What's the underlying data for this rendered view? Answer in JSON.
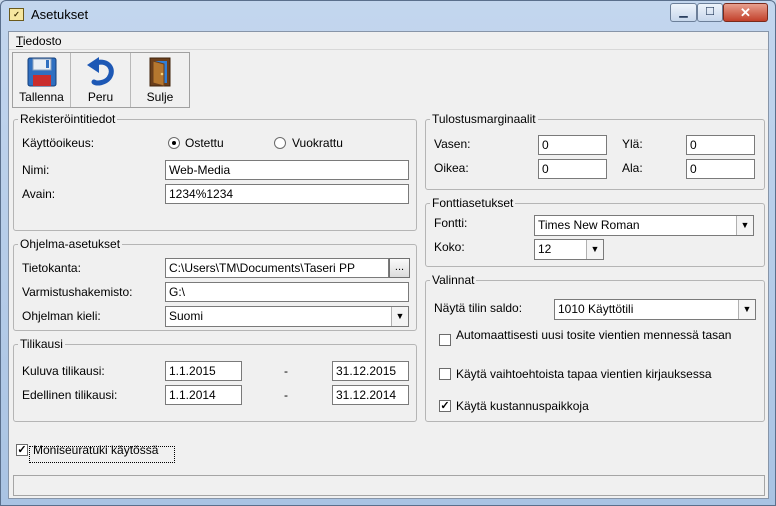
{
  "window": {
    "title": "Asetukset"
  },
  "menu": {
    "file_accel": "T",
    "file_rest": "iedosto"
  },
  "toolbar": {
    "save": "Tallenna",
    "undo": "Peru",
    "close": "Sulje"
  },
  "registration": {
    "legend": "Rekisteröintitiedot",
    "license_label": "Käyttöoikeus:",
    "license_options": [
      "Ostettu",
      "Vuokrattu"
    ],
    "license_selected": "Ostettu",
    "name_label": "Nimi:",
    "name_value": "Web-Media",
    "key_label": "Avain:",
    "key_value": "1234%1234"
  },
  "program": {
    "legend": "Ohjelma-asetukset",
    "database_label": "Tietokanta:",
    "database_value": "C:\\Users\\TM\\Documents\\Taseri PP",
    "browse_label": "...",
    "backup_label": "Varmistushakemisto:",
    "backup_value": "G:\\",
    "language_label": "Ohjelman kieli:",
    "language_value": "Suomi"
  },
  "fiscal": {
    "legend": "Tilikausi",
    "current_label": "Kuluva tilikausi:",
    "current_start": "1.1.2015",
    "current_end": "31.12.2015",
    "previous_label": "Edellinen tilikausi:",
    "previous_start": "1.1.2014",
    "previous_end": "31.12.2014",
    "dash": "-"
  },
  "multi_company": {
    "label": "Moniseuratuki käytössä",
    "checked": true
  },
  "margins": {
    "legend": "Tulostusmarginaalit",
    "left_label": "Vasen:",
    "left_value": "0",
    "top_label": "Ylä:",
    "top_value": "0",
    "right_label": "Oikea:",
    "right_value": "0",
    "bottom_label": "Ala:",
    "bottom_value": "0"
  },
  "fonts": {
    "legend": "Fonttiasetukset",
    "font_label": "Fontti:",
    "font_value": "Times New Roman",
    "size_label": "Koko:",
    "size_value": "12"
  },
  "options": {
    "legend": "Valinnat",
    "balance_label": "Näytä tilin saldo:",
    "balance_value": "1010 Käyttötili",
    "auto_voucher_label": "Automaattisesti uusi tosite vientien mennessä tasan",
    "auto_voucher_checked": false,
    "alt_entry_label": "Käytä vaihtoehtoista tapaa vientien kirjauksessa",
    "alt_entry_checked": false,
    "cost_centers_label": "Käytä kustannuspaikkoja",
    "cost_centers_checked": true
  },
  "colors": {
    "accent": "#1a4c8f",
    "close_button": "#c2402a"
  },
  "icons": {
    "save": "floppy-disk-icon",
    "undo": "undo-arrow-icon",
    "close": "door-exit-icon"
  }
}
